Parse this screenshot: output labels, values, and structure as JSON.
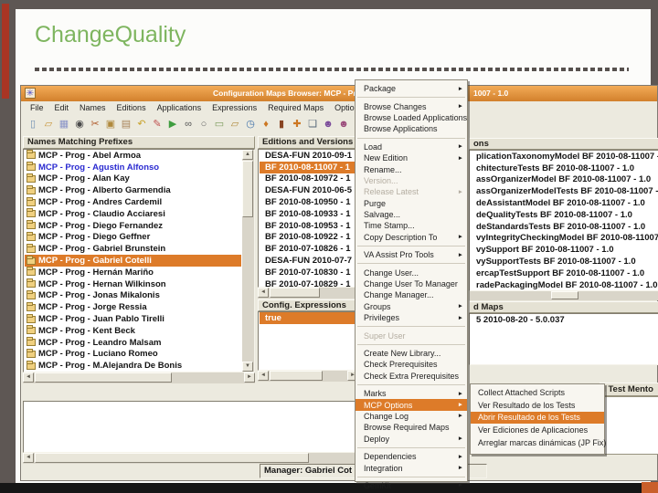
{
  "slide": {
    "title": "ChangeQuality"
  },
  "colors": {
    "accent_orange": "#dd7b29",
    "titlebar_orange": "#e9953f",
    "slide_title_green": "#7eb55f",
    "link_blue": "#2a2ad0",
    "left_bar_red": "#a83524"
  },
  "window": {
    "icon_glyph": "✳",
    "title_left": "Configuration Maps Browser: MCP - Pro",
    "title_right": "1007 - 1.0",
    "menubar": [
      "File",
      "Edit",
      "Names",
      "Editions",
      "Applications",
      "Expressions",
      "Required Maps",
      "Options"
    ],
    "toolbar": [
      {
        "name": "new-document-icon",
        "glyph": "▯",
        "color": "#6f8fb3"
      },
      {
        "name": "open-folder-icon",
        "glyph": "▱",
        "color": "#c8963c"
      },
      {
        "name": "save-icon",
        "glyph": "▦",
        "color": "#8a94c8"
      },
      {
        "name": "camera-icon",
        "glyph": "◉",
        "color": "#4a4a4a"
      },
      {
        "name": "cut-icon",
        "glyph": "✂",
        "color": "#b05a2a"
      },
      {
        "name": "copy-icon",
        "glyph": "▣",
        "color": "#b0893c"
      },
      {
        "name": "paste-icon",
        "glyph": "▤",
        "color": "#a8845a"
      },
      {
        "name": "undo-icon",
        "glyph": "↶",
        "color": "#c8a22a"
      },
      {
        "name": "pen-icon",
        "glyph": "✎",
        "color": "#c05050"
      },
      {
        "name": "run-icon",
        "glyph": "▶",
        "color": "#3f9d3f"
      },
      {
        "name": "spectacles-icon",
        "glyph": "∞",
        "color": "#555555"
      },
      {
        "name": "search-icon",
        "glyph": "○",
        "color": "#666666"
      },
      {
        "name": "edit-form-icon",
        "glyph": "▭",
        "color": "#7a9a5a"
      },
      {
        "name": "export-folder-icon",
        "glyph": "▱",
        "color": "#b08a3c"
      },
      {
        "name": "clock-icon",
        "glyph": "◷",
        "color": "#3a6ea8"
      },
      {
        "name": "merge-icon",
        "glyph": "♦",
        "color": "#cc7722"
      },
      {
        "name": "flag-icon",
        "glyph": "▮",
        "color": "#884422"
      },
      {
        "name": "compare-icon",
        "glyph": "✚",
        "color": "#cc7722"
      },
      {
        "name": "cascade-icon",
        "glyph": "❏",
        "color": "#556677"
      },
      {
        "name": "users-icon",
        "glyph": "☻",
        "color": "#7a4a9a"
      },
      {
        "name": "user-add-icon",
        "glyph": "☻",
        "color": "#9a4a7a"
      }
    ]
  },
  "names_panel": {
    "header": "Names Matching Prefixes",
    "items": [
      {
        "label": "MCP - Prog - Abel Armoa"
      },
      {
        "label": "MCP - Prog - Agustin Alfonso",
        "link": true
      },
      {
        "label": "MCP - Prog - Alan Kay"
      },
      {
        "label": "MCP - Prog - Alberto Garmendia"
      },
      {
        "label": "MCP - Prog - Andres Cardemil"
      },
      {
        "label": "MCP - Prog - Claudio Acciaresi"
      },
      {
        "label": "MCP - Prog - Diego Fernandez"
      },
      {
        "label": "MCP - Prog - Diego Geffner"
      },
      {
        "label": "MCP - Prog - Gabriel Brunstein"
      },
      {
        "label": "MCP - Prog - Gabriel Cotelli",
        "selected": true
      },
      {
        "label": "MCP - Prog - Hernán Mariño"
      },
      {
        "label": "MCP - Prog - Hernan Wilkinson"
      },
      {
        "label": "MCP - Prog - Jonas Mikalonis"
      },
      {
        "label": "MCP - Prog - Jorge Ressia"
      },
      {
        "label": "MCP - Prog - Juan Pablo Tirelli"
      },
      {
        "label": "MCP - Prog - Kent Beck"
      },
      {
        "label": "MCP - Prog - Leandro Malsam"
      },
      {
        "label": "MCP - Prog - Luciano Romeo"
      },
      {
        "label": "MCP - Prog - M.Alejandra De Bonis"
      }
    ]
  },
  "editions_panel": {
    "header": "Editions and Versions",
    "items": [
      {
        "label": "DESA-FUN 2010-09-1"
      },
      {
        "label": "BF 2010-08-11007 - 1",
        "selected": true
      },
      {
        "label": "BF 2010-08-10972 - 1"
      },
      {
        "label": "DESA-FUN 2010-06-5"
      },
      {
        "label": "BF 2010-08-10950 - 1"
      },
      {
        "label": "BF 2010-08-10933 - 1"
      },
      {
        "label": "BF 2010-08-10953 - 1"
      },
      {
        "label": "BF 2010-08-10922 - 1"
      },
      {
        "label": "BF 2010-07-10826 - 1"
      },
      {
        "label": "DESA-FUN 2010-07-7"
      },
      {
        "label": "BF 2010-07-10830 - 1"
      },
      {
        "label": "BF 2010-07-10829 - 1"
      }
    ]
  },
  "config_panel": {
    "header": "Config. Expressions",
    "items": [
      {
        "label": "true",
        "selected": true
      }
    ]
  },
  "applications_panel": {
    "header_fragment": "ons",
    "items": [
      {
        "label": "plicationTaxonomyModel BF 2010-08-11007 - 1.0"
      },
      {
        "label": "chitectureTests BF 2010-08-11007 - 1.0"
      },
      {
        "label": "assOrganizerModel BF 2010-08-11007 - 1.0"
      },
      {
        "label": "assOrganizerModelTests BF 2010-08-11007 - 1.0"
      },
      {
        "label": "deAssistantModel BF 2010-08-11007 - 1.0"
      },
      {
        "label": "deQualityTests BF 2010-08-11007 - 1.0"
      },
      {
        "label": "deStandardsTests BF 2010-08-11007 - 1.0"
      },
      {
        "label": "vyIntegrityCheckingModel BF 2010-08-11007 - 1.0"
      },
      {
        "label": "vySupport BF 2010-08-11007 - 1.0"
      },
      {
        "label": "vySupportTests BF 2010-08-11007 - 1.0"
      },
      {
        "label": "ercapTestSupport BF 2010-08-11007 - 1.0"
      },
      {
        "label": "radePackagingModel BF 2010-08-11007 - 1.0"
      }
    ]
  },
  "required_maps_panel": {
    "header_fragment": "d Maps",
    "items": [
      {
        "label": "5 2010-08-20 - 5.0.037"
      }
    ]
  },
  "background_window": {
    "title_fragment": "d Test Mento"
  },
  "status_bar": {
    "manager": "Manager: Gabriel Cot"
  },
  "context_menu": {
    "items": [
      {
        "label": "Package",
        "arrow": true
      },
      {
        "type": "sep"
      },
      {
        "label": "Browse Changes",
        "arrow": true
      },
      {
        "label": "Browse Loaded Applications"
      },
      {
        "label": "Browse Applications"
      },
      {
        "type": "sep"
      },
      {
        "label": "Load",
        "arrow": true
      },
      {
        "label": "New Edition",
        "arrow": true
      },
      {
        "label": "Rename..."
      },
      {
        "label": "Version...",
        "disabled": true
      },
      {
        "label": "Release Latest",
        "disabled": true,
        "arrow": true
      },
      {
        "label": "Purge"
      },
      {
        "label": "Salvage..."
      },
      {
        "label": "Time Stamp..."
      },
      {
        "label": "Copy Description To",
        "arrow": true
      },
      {
        "type": "sep"
      },
      {
        "label": "VA Assist Pro Tools",
        "arrow": true
      },
      {
        "type": "sep"
      },
      {
        "label": "Change User..."
      },
      {
        "label": "Change User To Manager"
      },
      {
        "label": "Change Manager..."
      },
      {
        "label": "Groups",
        "arrow": true
      },
      {
        "label": "Privileges",
        "arrow": true
      },
      {
        "type": "sep"
      },
      {
        "label": "Super User",
        "disabled": true
      },
      {
        "type": "sep"
      },
      {
        "label": "Create New Library..."
      },
      {
        "label": "Check Prerequisites"
      },
      {
        "label": "Check Extra Prerequisites"
      },
      {
        "type": "sep"
      },
      {
        "label": "Marks",
        "arrow": true
      },
      {
        "label": "MCP Options",
        "arrow": true,
        "highlight": true
      },
      {
        "label": "Change Log",
        "arrow": true
      },
      {
        "label": "Browse Required Maps"
      },
      {
        "label": "Deploy",
        "arrow": true
      },
      {
        "type": "sep"
      },
      {
        "label": "Dependencies",
        "arrow": true
      },
      {
        "label": "Integration",
        "arrow": true
      },
      {
        "type": "sep"
      },
      {
        "label": "GemKit",
        "arrow": true
      }
    ]
  },
  "submenu": {
    "items": [
      {
        "label": "Collect Attached Scripts"
      },
      {
        "label": "Ver Resultado de los Tests"
      },
      {
        "label": "Abrir Resultado de los Tests",
        "highlight": true
      },
      {
        "label": "Ver Ediciones de Aplicaciones"
      },
      {
        "label": "Arreglar marcas dinámicas (JP Fix)"
      }
    ]
  }
}
